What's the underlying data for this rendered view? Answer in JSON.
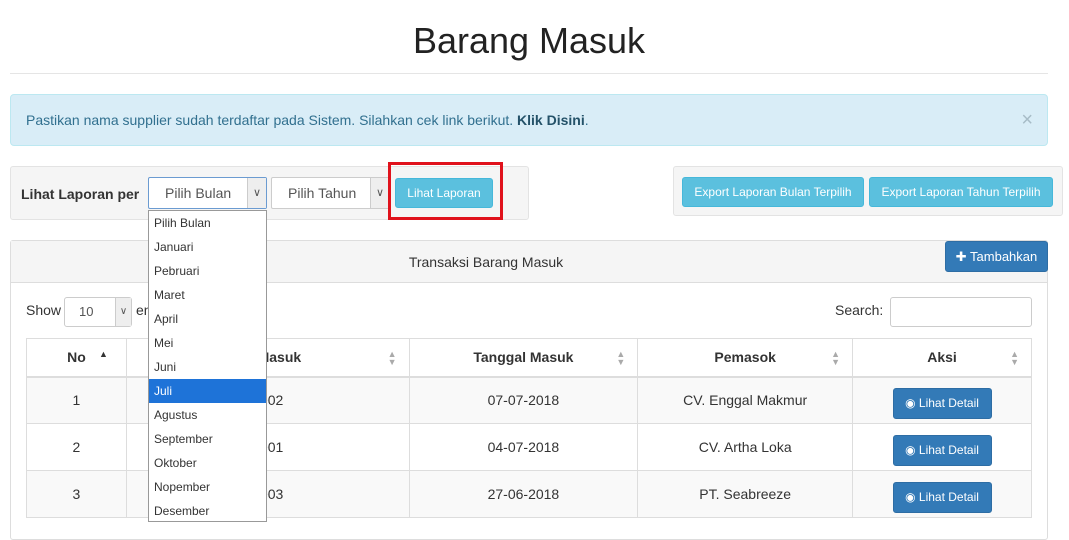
{
  "page": {
    "title": "Barang Masuk"
  },
  "alert": {
    "text": "Pastikan nama supplier sudah terdaftar pada Sistem. Silahkan cek link berikut.",
    "link": "Klik Disini",
    "period": ".",
    "close": "×"
  },
  "filter": {
    "label": "Lihat Laporan per",
    "bulan_value": "Pilih Bulan",
    "tahun_value": "Pilih Tahun",
    "button": "Lihat Laporan",
    "months": [
      "Pilih Bulan",
      "Januari",
      "Pebruari",
      "Maret",
      "April",
      "Mei",
      "Juni",
      "Juli",
      "Agustus",
      "September",
      "Oktober",
      "Nopember",
      "Desember"
    ],
    "highlighted": "Juli"
  },
  "export": {
    "bulan": "Export Laporan Bulan Terpilih",
    "tahun": "Export Laporan Tahun Terpilih"
  },
  "panel": {
    "title": "Transaksi Barang Masuk",
    "add_button": "Tambahkan"
  },
  "datatable": {
    "show_label": "Show",
    "entries_value": "10",
    "entries_suffix": "en",
    "search_label": "Search:",
    "columns": [
      "No",
      "ksi Masuk",
      "Tanggal Masuk",
      "Pemasok",
      "Aksi"
    ],
    "rows": [
      {
        "no": "1",
        "id": "0002",
        "tanggal": "07-07-2018",
        "pemasok": "CV. Enggal Makmur",
        "aksi": "Lihat Detail"
      },
      {
        "no": "2",
        "id": "0001",
        "tanggal": "04-07-2018",
        "pemasok": "CV. Artha Loka",
        "aksi": "Lihat Detail"
      },
      {
        "no": "3",
        "id": "0003",
        "tanggal": "27-06-2018",
        "pemasok": "PT. Seabreeze",
        "aksi": "Lihat Detail"
      }
    ]
  },
  "colors": {
    "info_button": "#5bc0de",
    "primary_button": "#337ab7",
    "highlight_box": "#e0121c",
    "alert_bg": "#d9edf7"
  }
}
